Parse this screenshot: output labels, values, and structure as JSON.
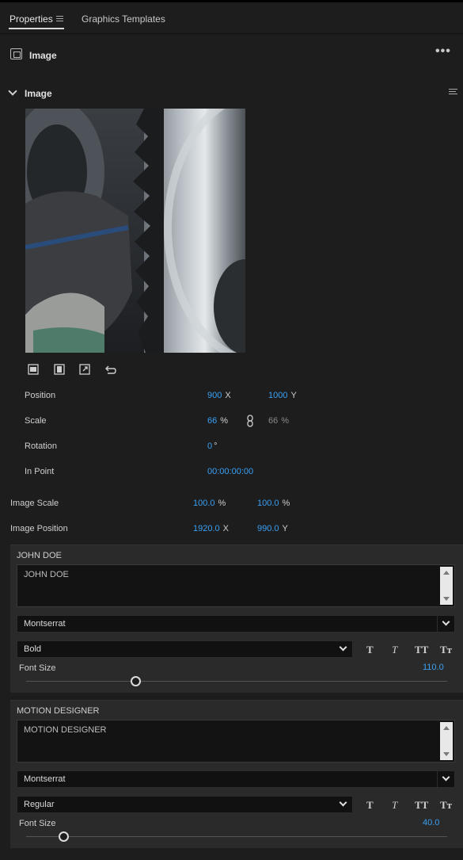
{
  "tabs": [
    {
      "label": "Properties",
      "active": true
    },
    {
      "label": "Graphics Templates",
      "active": false
    }
  ],
  "layer": {
    "title": "Image",
    "more": "•••"
  },
  "section": {
    "title": "Image"
  },
  "transform": {
    "position": {
      "label": "Position",
      "x": "900",
      "x_unit": "X",
      "y": "1000",
      "y_unit": "Y"
    },
    "scale": {
      "label": "Scale",
      "value": "66",
      "unit": "%",
      "linked_value": "66",
      "linked_unit": "%"
    },
    "rotation": {
      "label": "Rotation",
      "value": "0",
      "unit": "°"
    },
    "in_point": {
      "label": "In Point",
      "value": "00:00:00:00"
    }
  },
  "image_scale": {
    "label": "Image Scale",
    "x": "100.0",
    "x_unit": "%",
    "y": "100.0",
    "y_unit": "%"
  },
  "image_position": {
    "label": "Image Position",
    "x": "1920.0",
    "x_unit": "X",
    "y": "990.0",
    "y_unit": "Y"
  },
  "text_panels": [
    {
      "title": "JOHN DOE",
      "text": "JOHN DOE",
      "font": "Montserrat",
      "style": "Bold",
      "style_buttons": [
        "T",
        "T",
        "TT",
        "Tт"
      ],
      "font_size_label": "Font Size",
      "font_size": "110.0",
      "slider_fraction": 0.26
    },
    {
      "title": "MOTION DESIGNER",
      "text": "MOTION DESIGNER",
      "font": "Montserrat",
      "style": "Regular",
      "style_buttons": [
        "T",
        "T",
        "TT",
        "Tт"
      ],
      "font_size_label": "Font Size",
      "font_size": "40.0",
      "slider_fraction": 0.09
    }
  ],
  "icons": [
    "menu-icon",
    "image-layer-icon",
    "chevron-down-icon",
    "fit-frame-icon",
    "fill-frame-icon",
    "resize-icon",
    "reset-icon",
    "link-icon"
  ],
  "colors": {
    "accent": "#3aa0f5",
    "background": "#1d1d1d",
    "panel": "#2a2a2a",
    "field": "#131313"
  }
}
